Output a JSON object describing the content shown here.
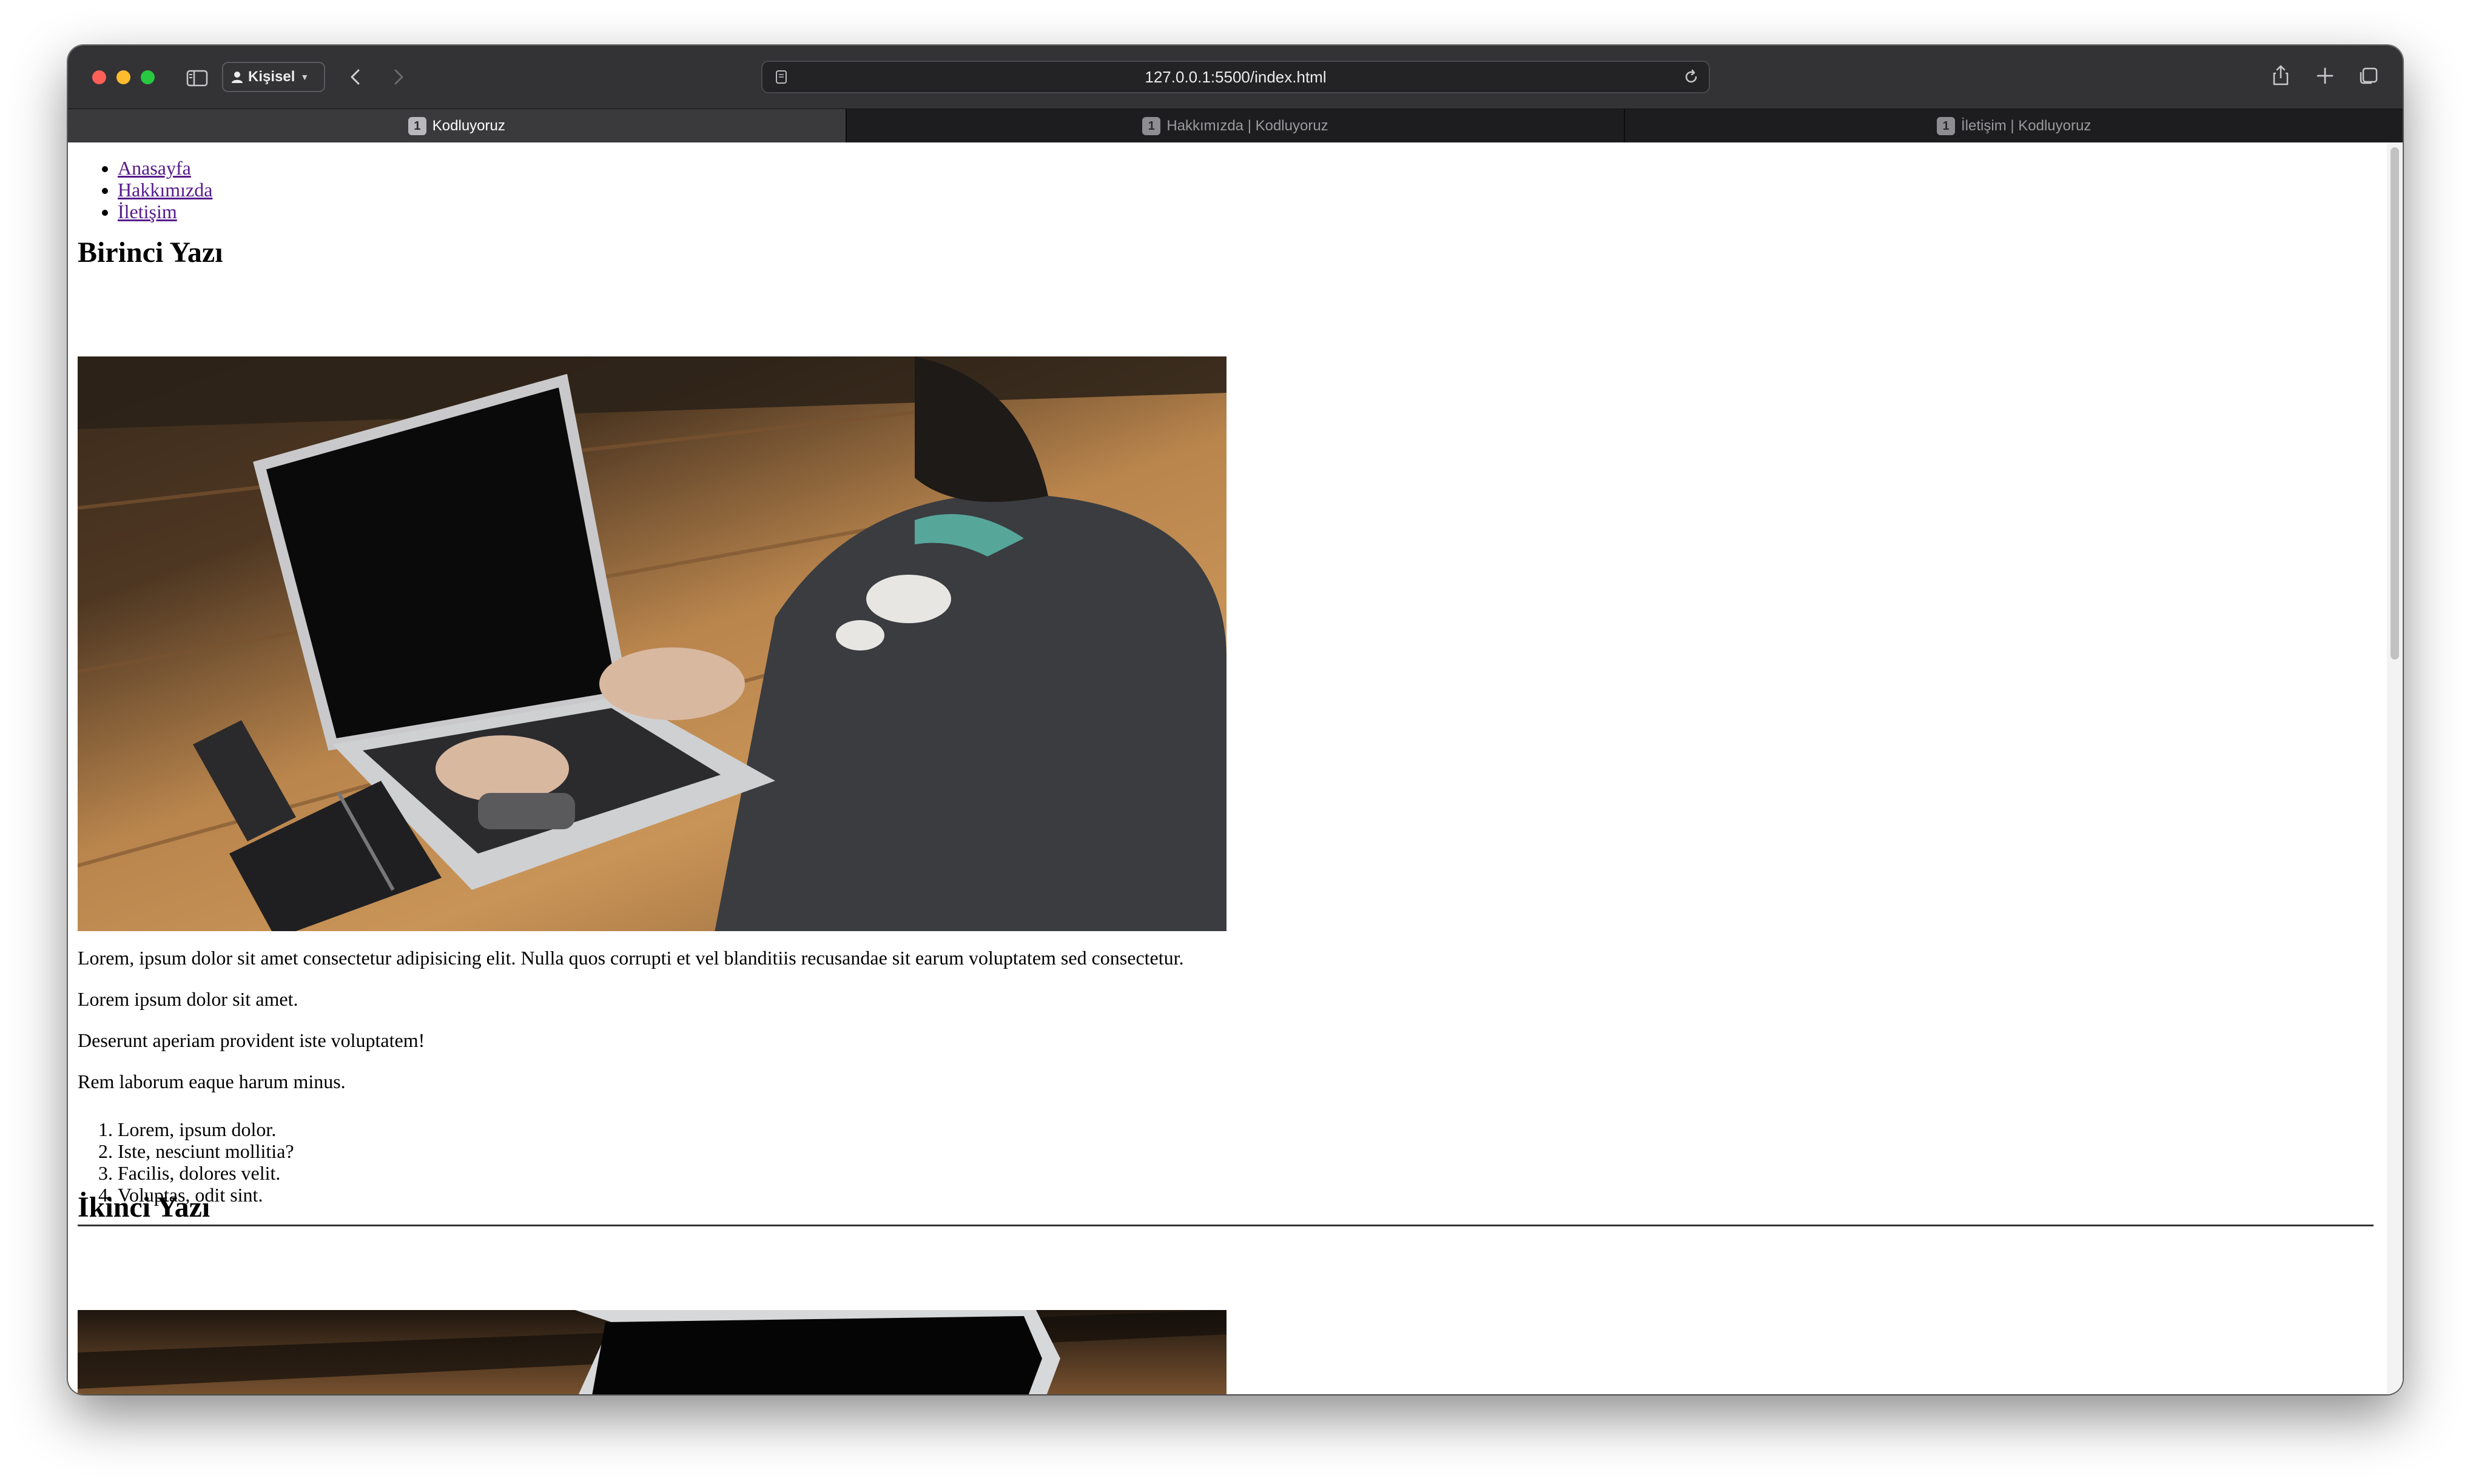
{
  "browser": {
    "profile_label": "Kişisel",
    "url": "127.0.0.1:5500/index.html",
    "tabs": [
      {
        "label": "Kodluyoruz",
        "favicon": "1",
        "active": true
      },
      {
        "label": "Hakkımızda | Kodluyoruz",
        "favicon": "1",
        "active": false
      },
      {
        "label": "İletişim | Kodluyoruz",
        "favicon": "1",
        "active": false
      }
    ],
    "icons": [
      "sidebar-icon",
      "user-icon",
      "chevron-down-icon",
      "back-arrow-icon",
      "forward-arrow-icon",
      "page-icon",
      "reload-icon",
      "share-icon",
      "plus-icon",
      "tabs-overview-icon"
    ]
  },
  "page": {
    "nav": [
      "Anasayfa",
      "Hakkımızda",
      "İletişim"
    ],
    "article1": {
      "title": "Birinci Yazı",
      "image_subject": "person typing on a laptop at a wooden table",
      "paragraphs": [
        "Lorem, ipsum dolor sit amet consectetur adipisicing elit. Nulla quos corrupti et vel blanditiis recusandae sit earum voluptatem sed consectetur.",
        "Lorem ipsum dolor sit amet.",
        "Deserunt aperiam provident iste voluptatem!",
        "Rem laborum eaque harum minus."
      ],
      "list": [
        "Lorem, ipsum dolor.",
        "Iste, nesciunt mollitia?",
        "Facilis, dolores velit.",
        "Voluptas, odit sint."
      ]
    },
    "article2": {
      "title": "İkinci Yazı"
    }
  },
  "colors": {
    "toolbar": "#333335",
    "tabbar": "#1d1d1f",
    "link": "#551a8b"
  }
}
